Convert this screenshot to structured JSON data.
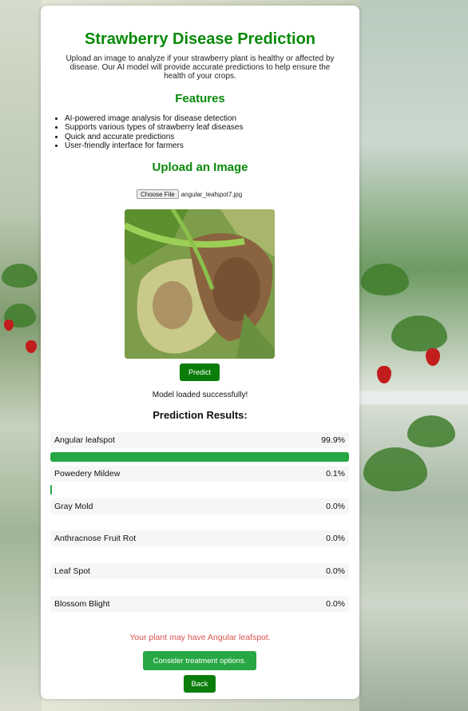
{
  "page": {
    "title": "Strawberry Disease Prediction",
    "intro": "Upload an image to analyze if your strawberry plant is healthy or affected by disease. Our AI model will provide accurate predictions to help ensure the health of your crops."
  },
  "features": {
    "heading": "Features",
    "items": [
      "AI-powered image analysis for disease detection",
      "Supports various types of strawberry leaf diseases",
      "Quick and accurate predictions",
      "User-friendly interface for farmers"
    ]
  },
  "upload": {
    "heading": "Upload an Image",
    "choose_label": "Choose File",
    "file_name": "angular_leafspot7.jpg",
    "predict_label": "Predict",
    "status": "Model loaded successfully!"
  },
  "results": {
    "title": "Prediction Results:",
    "items": [
      {
        "name": "Angular leafspot",
        "percent": "99.9%",
        "fraction": 0.999
      },
      {
        "name": "Powedery Mildew",
        "percent": "0.1%",
        "fraction": 0.001
      },
      {
        "name": "Gray Mold",
        "percent": "0.0%",
        "fraction": 0
      },
      {
        "name": "Anthracnose Fruit Rot",
        "percent": "0.0%",
        "fraction": 0
      },
      {
        "name": "Leaf Spot",
        "percent": "0.0%",
        "fraction": 0
      },
      {
        "name": "Blossom Blight",
        "percent": "0.0%",
        "fraction": 0
      }
    ]
  },
  "diagnosis": {
    "message": "Your plant may have Angular leafspot.",
    "treatment_label": "Consider treatment options.",
    "back_label": "Back"
  },
  "colors": {
    "heading_green": "#0a8a0a",
    "bar_green": "#28a745",
    "warning_red": "#d9534f"
  }
}
